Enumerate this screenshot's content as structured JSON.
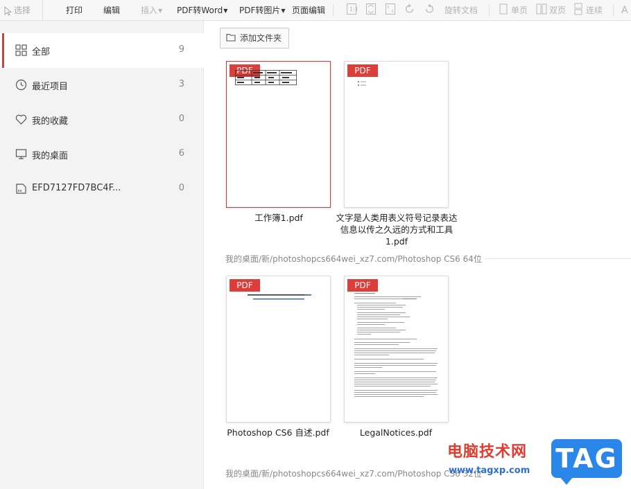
{
  "toolbar": {
    "select": "选择",
    "print": "打印",
    "edit": "编辑",
    "insert": "插入",
    "pdf_to_word": "PDF转Word",
    "pdf_to_image": "PDF转图片",
    "page_edit": "页面编辑",
    "rotate_doc": "旋转文档",
    "single_page": "单页",
    "double_page": "双页",
    "continuous": "连续",
    "more": "A"
  },
  "sidebar": {
    "items": [
      {
        "label": "全部",
        "count": "9",
        "icon": "grid-icon"
      },
      {
        "label": "最近项目",
        "count": "3",
        "icon": "clock-icon"
      },
      {
        "label": "我的收藏",
        "count": "0",
        "icon": "heart-icon"
      },
      {
        "label": "我的桌面",
        "count": "6",
        "icon": "monitor-icon"
      },
      {
        "label": "EFD7127FD7BC4F...",
        "count": "0",
        "icon": "drive-icon"
      }
    ]
  },
  "main": {
    "add_folder": "添加文件夹",
    "badge": "PDF",
    "docs": [
      {
        "name": "工作簿1.pdf"
      },
      {
        "name": "文字是人类用表义符号记录表达信息以传之久远的方式和工具 1.pdf"
      },
      {
        "name": "Photoshop CS6 自述.pdf"
      },
      {
        "name": "LegalNotices.pdf"
      }
    ],
    "path1": "我的桌面/新/photoshopcs664wei_xz7.com/Photoshop CS6 64位",
    "path2": "我的桌面/新/photoshopcs664wei_xz7.com/Photoshop CS6 32位"
  },
  "watermark": {
    "title": "电脑技术网",
    "url": "www.tagxp.com",
    "tag": "TAG"
  },
  "colors": {
    "accent": "#d93c3c",
    "pdf_badge": "#de3e3a",
    "link_blue": "#2d6fd6"
  }
}
